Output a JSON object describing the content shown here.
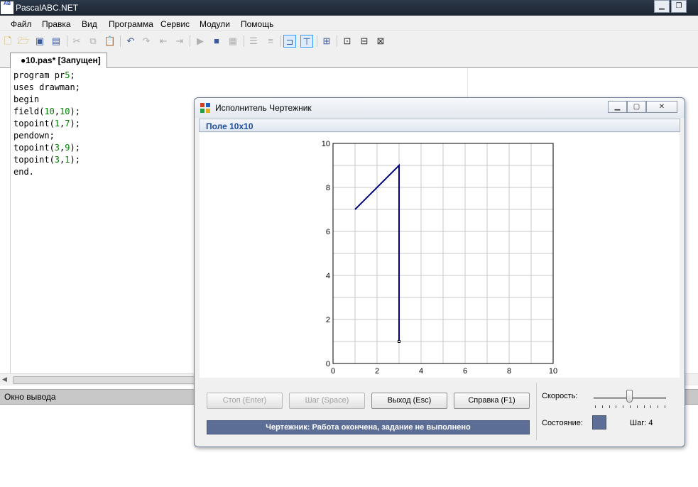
{
  "window": {
    "title": "PascalABC.NET",
    "app_icon_text": "AB"
  },
  "menu": [
    "Файл",
    "Правка",
    "Вид",
    "Программа",
    "Сервис",
    "Модули",
    "Помощь"
  ],
  "toolbar": {
    "icons": [
      "new-file-icon",
      "open-folder-icon",
      "save-icon",
      "save-all-icon",
      "cut-icon",
      "copy-icon",
      "paste-icon",
      "undo-icon",
      "redo-icon",
      "find-icon",
      "replace-icon",
      "run-icon",
      "stop-icon",
      "compile-icon",
      "comment-icon",
      "uncomment-icon",
      "console-icon",
      "output-icon",
      "debug-icon",
      "step-over-icon",
      "step-into-icon",
      "step-out-icon"
    ]
  },
  "tab": {
    "label": "●10.pas* [Запущен]"
  },
  "editor": {
    "lines": [
      "program pr5;",
      "uses drawman;",
      "begin",
      "field(10,10);",
      "topoint(1,7);",
      "pendown;",
      "topoint(3,9);",
      "topoint(3,1);",
      "end."
    ]
  },
  "output": {
    "title": "Окно вывода"
  },
  "dialog": {
    "title": "Исполнитель Чертежник",
    "field_title": "Поле 10x10",
    "buttons": {
      "stop": "Стоп (Enter)",
      "step": "Шаг (Space)",
      "exit": "Выход (Esc)",
      "help": "Справка (F1)"
    },
    "status": "Чертежник: Работа окончена, задание не выполнено",
    "speed_label": "Скорость:",
    "speed_level": 0.5,
    "state_label": "Состояние:",
    "step_label": "Шаг: 4",
    "state_color": "#5d6e96"
  },
  "chart_data": {
    "type": "line",
    "xlim": [
      0,
      10
    ],
    "ylim": [
      0,
      10
    ],
    "grid": true,
    "xticks": [
      0,
      2,
      4,
      6,
      8,
      10
    ],
    "yticks": [
      0,
      2,
      4,
      6,
      8,
      10
    ],
    "line_color": "#000080",
    "series": [
      {
        "points": [
          [
            1,
            7
          ],
          [
            3,
            9
          ],
          [
            3,
            1
          ]
        ]
      }
    ],
    "pen_position": [
      3,
      1
    ]
  }
}
